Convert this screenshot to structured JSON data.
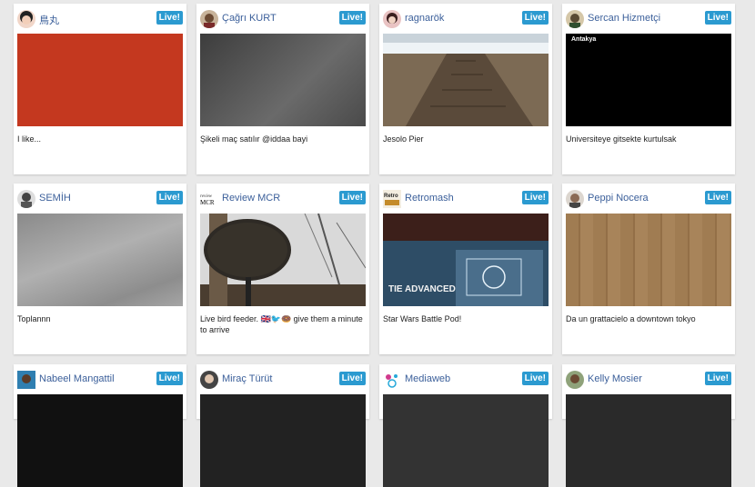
{
  "cards": [
    {
      "user": "鳥丸",
      "live": "Live!",
      "title": "I like...",
      "thumb_color": "#c4381f"
    },
    {
      "user": "Çağrı KURT",
      "live": "Live!",
      "title": "Şikeli maç satılır @iddaa bayi",
      "thumb_color": "#505050"
    },
    {
      "user": "ragnarök",
      "live": "Live!",
      "title": "Jesolo Pier",
      "thumb_color": "#7a6a55"
    },
    {
      "user": "Sercan Hizmetçi",
      "live": "Live!",
      "title": "Universiteye gitsekte kurtulsak",
      "thumb_color": "#000000",
      "thumb_text": "Antakya"
    },
    {
      "user": "SEMİH",
      "live": "Live!",
      "title": "Toplannn",
      "thumb_color": "#9a9a9a"
    },
    {
      "user": "Review MCR",
      "live": "Live!",
      "title": "Live bird feeder. 🇬🇧🐦🍩 give them a minute to arrive",
      "thumb_color": "#3d3a36",
      "avatar_text": "MCR"
    },
    {
      "user": "Retromash",
      "live": "Live!",
      "title": "Star Wars Battle Pod!",
      "thumb_color": "#3a5770",
      "thumb_text": "TIE ADVANCED",
      "avatar_text": "Retro"
    },
    {
      "user": "Peppi Nocera",
      "live": "Live!",
      "title": "Da un grattacielo a downtown tokyo",
      "thumb_color": "#a07c52"
    },
    {
      "user": "Nabeel Mangattil",
      "live": "Live!"
    },
    {
      "user": "Miraç Türüt",
      "live": "Live!"
    },
    {
      "user": "Mediaweb",
      "live": "Live!"
    },
    {
      "user": "Kelly Mosier",
      "live": "Live!"
    }
  ],
  "colors": {
    "accent": "#2b9ad0",
    "link": "#3b5f9a",
    "background": "#e9e9e9"
  }
}
